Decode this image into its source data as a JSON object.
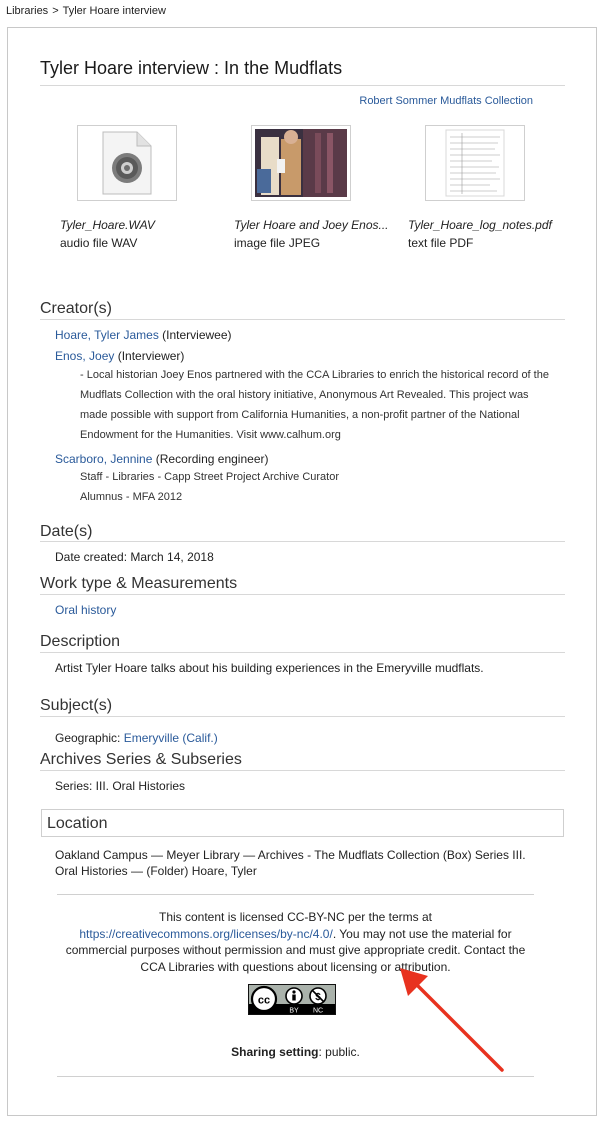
{
  "breadcrumb": {
    "root": "Libraries",
    "separator": ">",
    "current": "Tyler Hoare interview"
  },
  "title": "Tyler Hoare interview : In the Mudflats",
  "collection_link": "Robert Sommer Mudflats Collection",
  "files": [
    {
      "name": "Tyler_Hoare.WAV",
      "type": "audio file WAV",
      "icon": "audio-file-icon"
    },
    {
      "name": "Tyler Hoare and Joey Enos...",
      "type": "image file JPEG",
      "icon": "photo-thumbnail"
    },
    {
      "name": "Tyler_Hoare_log_notes.pdf",
      "type": "text file PDF",
      "icon": "document-thumbnail"
    }
  ],
  "creators": {
    "heading": "Creator(s)",
    "c1": {
      "name": "Hoare, Tyler James",
      "role": "(Interviewee)"
    },
    "c2": {
      "name": "Enos, Joey",
      "role": "(Interviewer)",
      "note": "- Local historian Joey Enos partnered with the CCA Libraries to enrich the historical record of the Mudflats Collection with the oral history initiative, Anonymous Art Revealed. This project was made possible with support from California Humanities, a non-profit partner of the National Endowment for the Humanities. Visit www.calhum.org"
    },
    "c3": {
      "name": "Scarboro, Jennine",
      "role": "(Recording engineer)",
      "note1": "Staff - Libraries - Capp Street Project Archive Curator",
      "note2": "Alumnus - MFA 2012"
    }
  },
  "dates": {
    "heading": "Date(s)",
    "created": "Date created: March 14, 2018"
  },
  "work_type": {
    "heading": "Work type & Measurements",
    "value": "Oral history"
  },
  "description": {
    "heading": "Description",
    "text": "Artist Tyler Hoare talks about his building experiences in the Emeryville mudflats."
  },
  "subjects": {
    "heading": "Subject(s)",
    "label": "Geographic:",
    "value": "Emeryville (Calif.)"
  },
  "archives": {
    "heading": "Archives Series & Subseries",
    "text": "Series: III. Oral Histories"
  },
  "location": {
    "heading": "Location",
    "text": "Oakland Campus — Meyer Library — Archives - The Mudflats Collection (Box) Series III. Oral Histories — (Folder) Hoare, Tyler"
  },
  "license": {
    "pre": "This content is licensed CC-BY-NC per the terms at",
    "url": "https://creativecommons.org/licenses/by-nc/4.0/",
    "post": ". You may not use the material for commercial purposes without permission and must give appropriate credit. Contact the CCA Libraries with questions about licensing or attribution.",
    "badge": {
      "cc": "cc",
      "by": "BY",
      "nc": "NC"
    }
  },
  "sharing": {
    "label": "Sharing setting",
    "value": ": public."
  },
  "colors": {
    "link": "#2a5a9a",
    "arrow": "#e8321f"
  }
}
